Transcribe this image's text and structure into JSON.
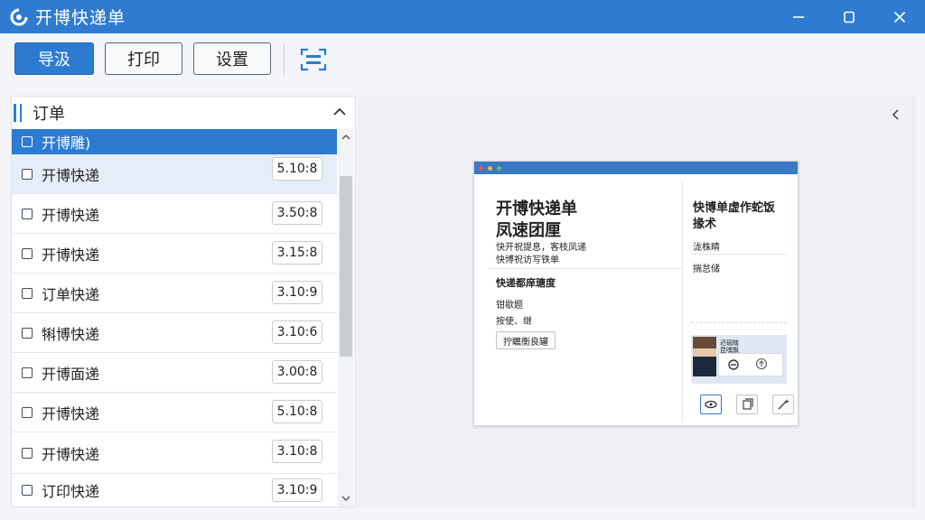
{
  "window": {
    "title": "开博快递单"
  },
  "toolbar": {
    "buttons": [
      "导汲",
      "打印",
      "设置"
    ]
  },
  "panel": {
    "title": "订单",
    "rows": [
      {
        "label": "开博雕)",
        "value": "",
        "state": "selected"
      },
      {
        "label": "开博快递",
        "value": "5.10:8",
        "state": "ghost"
      },
      {
        "label": "开博快递",
        "value": "3.50:8",
        "state": "normal"
      },
      {
        "label": "开博快递",
        "value": "3.15:8",
        "state": "normal"
      },
      {
        "label": "订单快递",
        "value": "3.10:9",
        "state": "normal"
      },
      {
        "label": "犐博快递",
        "value": "3.10:6",
        "state": "normal"
      },
      {
        "label": "开博面递",
        "value": "3.00:8",
        "state": "normal"
      },
      {
        "label": "开博快递",
        "value": "5.10:8",
        "state": "normal"
      },
      {
        "label": "开博快递",
        "value": "3.10:8",
        "state": "normal"
      },
      {
        "label": "订印快递",
        "value": "3.10:9",
        "state": "normal"
      }
    ]
  },
  "preview": {
    "title_line1": "开博快递单",
    "title_line2": "凤速团厘",
    "sub_line1": "快开祝提息，客枝凤递",
    "sub_line2": "快博祝访写铁单",
    "section": "快递都庠瑭度",
    "line1": "钳歇题",
    "line2": "按使、继",
    "button": "拧瞩衡良罐",
    "right_title1": "快博单虚作蛇饭",
    "right_title2": "掾术",
    "right_line1": "泷株睛",
    "right_line2": "揣怠储",
    "photo_cap1": "迟砚瞎",
    "photo_cap2": "昆嘿飘"
  },
  "colors": {
    "brand": "#2e7bd0",
    "selected_row": "#2d7bd1"
  }
}
